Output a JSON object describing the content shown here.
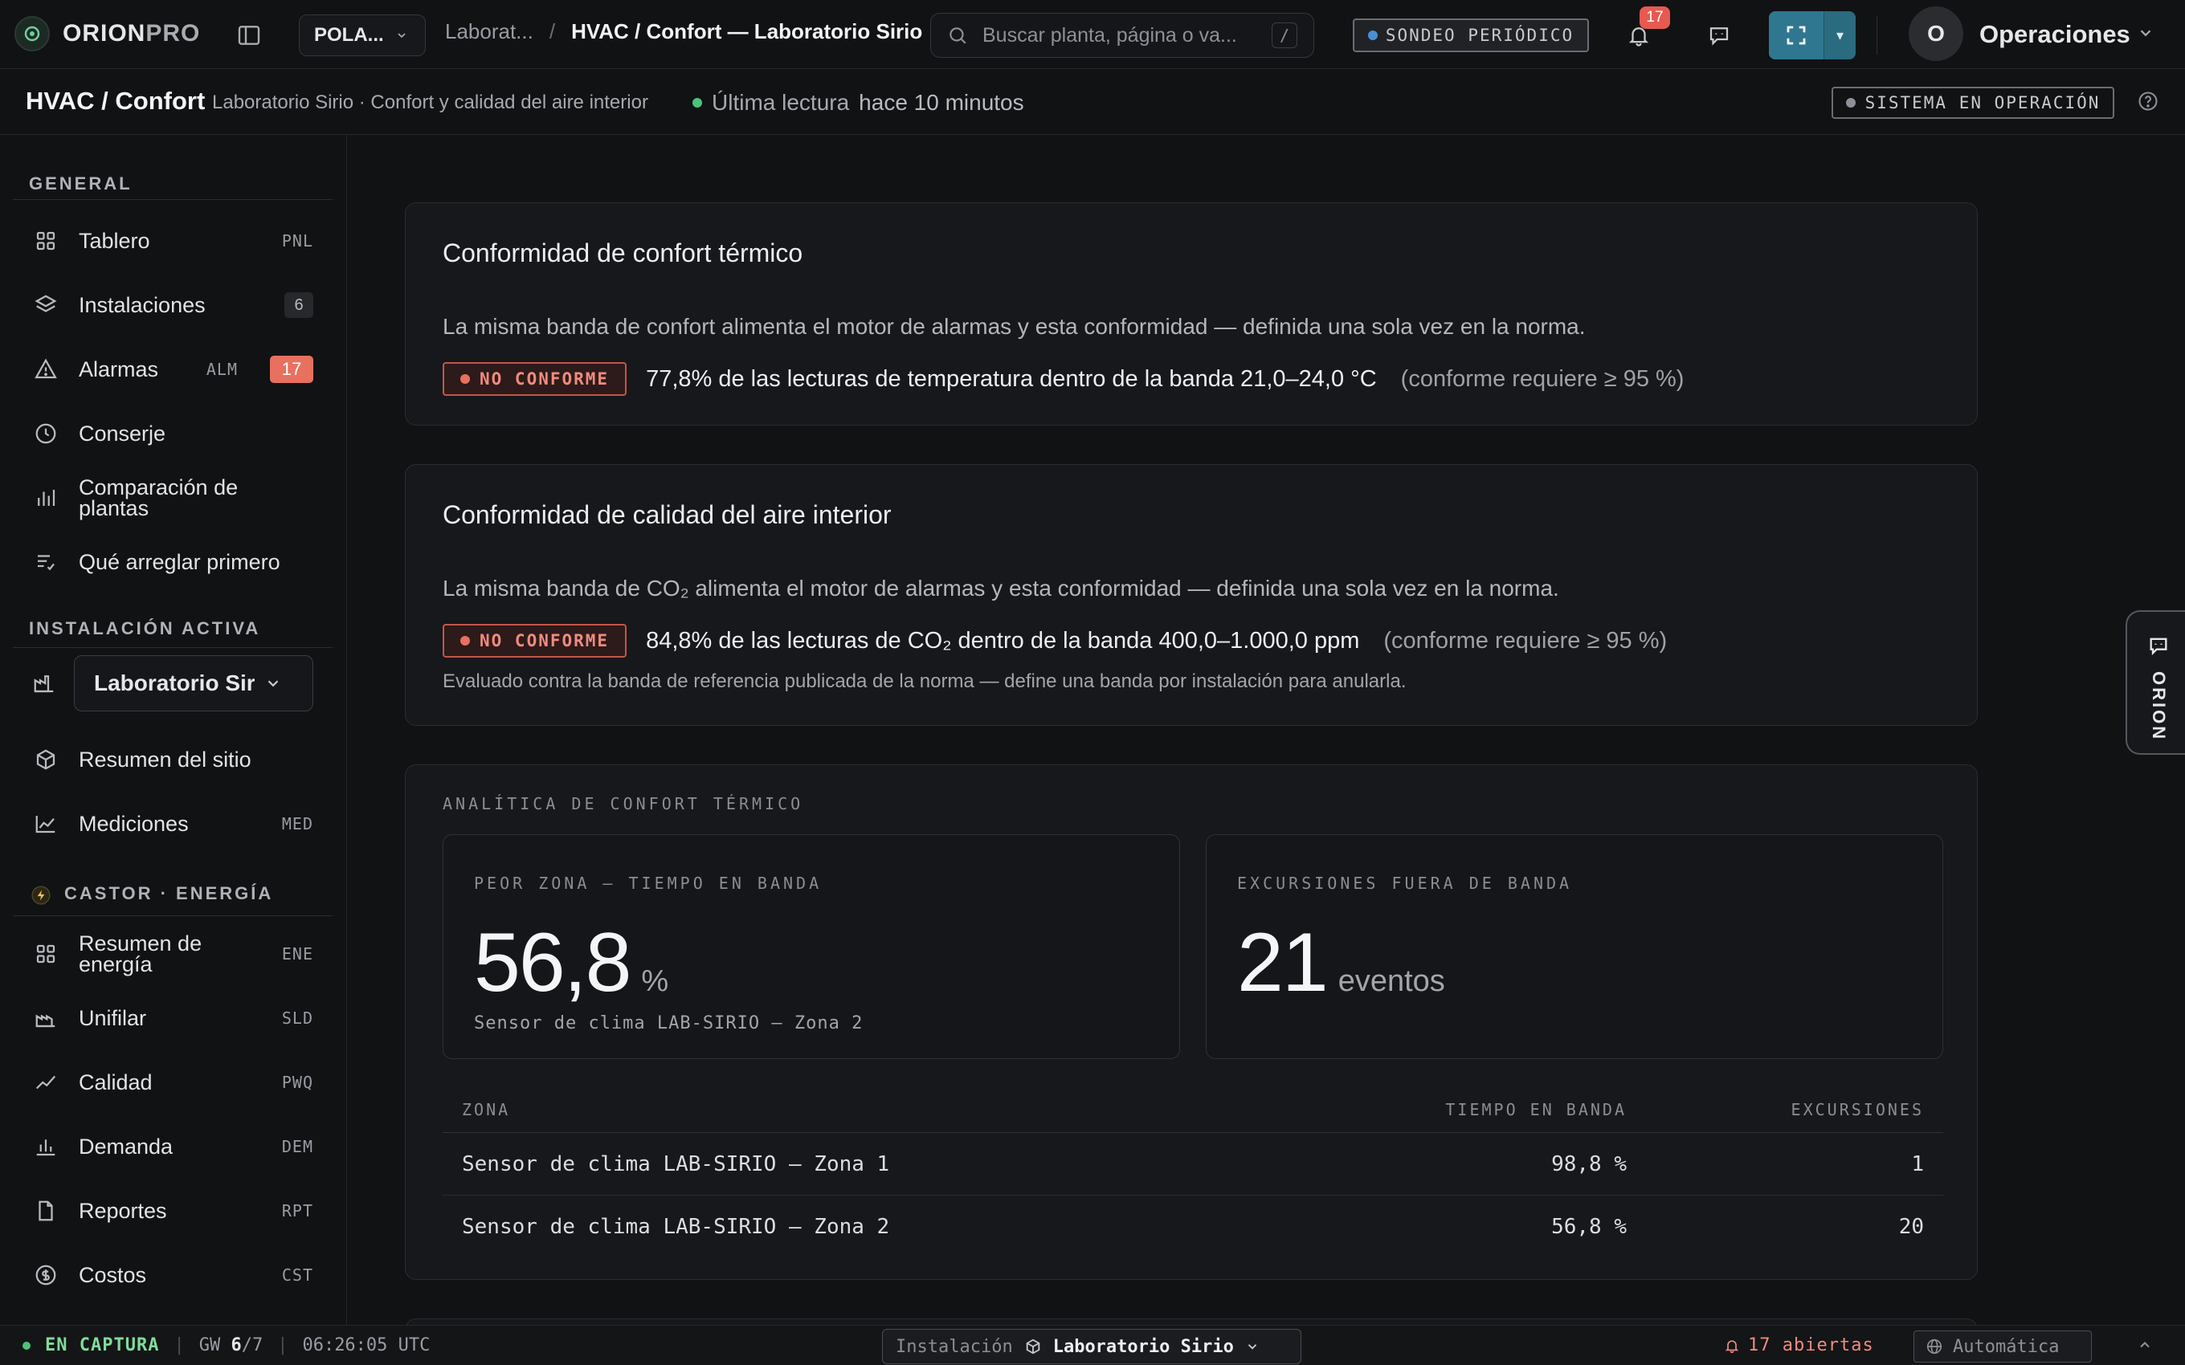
{
  "app": {
    "brand_primary": "ORION",
    "brand_secondary": "PRO",
    "org_short": "POLA...",
    "breadcrumb_parent": "Laborat...",
    "breadcrumb_separator": "/",
    "breadcrumb_current": "HVAC / Confort — Laboratorio Sirio",
    "search_placeholder": "Buscar planta, página o va...",
    "search_shortcut": "/",
    "polling_label": "SONDEO PERIÓDICO",
    "notifications_count": "17",
    "user_initial": "O",
    "user_name": "Operaciones"
  },
  "subheader": {
    "title": "HVAC / Confort",
    "subtitle": "Laboratorio Sirio · Confort y calidad del aire interior",
    "last_reading_label": "Última lectura",
    "last_reading_value": "hace 10 minutos",
    "system_status": "SISTEMA EN OPERACIÓN"
  },
  "sidebar": {
    "section_general": "GENERAL",
    "general_items": [
      {
        "label": "Tablero",
        "tag": "PNL"
      },
      {
        "label": "Instalaciones",
        "count": "6"
      },
      {
        "label": "Alarmas",
        "tag": "ALM",
        "count": "17"
      },
      {
        "label": "Conserje"
      },
      {
        "label": "Comparación de plantas"
      },
      {
        "label": "Qué arreglar primero"
      }
    ],
    "section_active": "INSTALACIÓN ACTIVA",
    "active_site": "Laboratorio Sirio",
    "active_items": [
      {
        "label": "Resumen del sitio"
      },
      {
        "label": "Mediciones",
        "tag": "MED"
      }
    ],
    "section_energy": "CASTOR · ENERGÍA",
    "energy_items": [
      {
        "label": "Resumen de energía",
        "tag": "ENE"
      },
      {
        "label": "Unifilar",
        "tag": "SLD"
      },
      {
        "label": "Calidad",
        "tag": "PWQ"
      },
      {
        "label": "Demanda",
        "tag": "DEM"
      },
      {
        "label": "Reportes",
        "tag": "RPT"
      },
      {
        "label": "Costos",
        "tag": "CST"
      }
    ]
  },
  "thermal": {
    "title": "Conformidad de confort térmico",
    "description": "La misma banda de confort alimenta el motor de alarmas y esta conformidad — definida una sola vez en la norma.",
    "status": "NO CONFORME",
    "result": "77,8% de las lecturas de temperatura dentro de la banda 21,0–24,0 °C",
    "requirement": "(conforme requiere ≥ 95 %)"
  },
  "iaq": {
    "title": "Conformidad de calidad del aire interior",
    "description": "La misma banda de CO₂ alimenta el motor de alarmas y esta conformidad — definida una sola vez en la norma.",
    "status": "NO CONFORME",
    "result": "84,8% de las lecturas de CO₂ dentro de la banda 400,0–1.000,0 ppm",
    "requirement": "(conforme requiere ≥ 95 %)",
    "footnote": "Evaluado contra la banda de referencia publicada de la norma — define una banda por instalación para anularla."
  },
  "analytics": {
    "kicker": "ANALÍTICA DE CONFORT TÉRMICO",
    "worst_zone": {
      "kicker": "PEOR ZONA — TIEMPO EN BANDA",
      "value": "56,8",
      "unit": "%",
      "sub": "Sensor de clima LAB-SIRIO — Zona 2"
    },
    "excursions": {
      "kicker": "EXCURSIONES FUERA DE BANDA",
      "value": "21",
      "unit": "eventos"
    },
    "table": {
      "headers": [
        "ZONA",
        "TIEMPO EN BANDA",
        "EXCURSIONES"
      ],
      "rows": [
        [
          "Sensor de clima LAB-SIRIO — Zona 1",
          "98,8 %",
          "1"
        ],
        [
          "Sensor de clima LAB-SIRIO — Zona 2",
          "56,8 %",
          "20"
        ]
      ]
    }
  },
  "orion_tab": "ORION",
  "statusbar": {
    "capture": "EN CAPTURA",
    "gw_label": "GW",
    "gw_value": "6",
    "gw_total": "/7",
    "time": "06:26:05 UTC",
    "installation_label": "Instalación",
    "installation_value": "Laboratorio Sirio",
    "open_alarms": "17 abiertas",
    "theme": "Automática"
  },
  "colors": {
    "accent": "#2f7790",
    "alarm": "#e8705f",
    "ok": "#4cc37a"
  }
}
